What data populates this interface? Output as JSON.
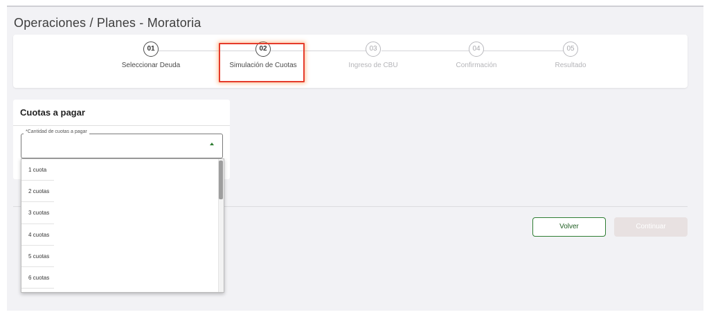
{
  "page": {
    "title": "Operaciones / Planes - Moratoria"
  },
  "stepper": {
    "steps": [
      {
        "number": "01",
        "label": "Seleccionar Deuda",
        "state": "done"
      },
      {
        "number": "02",
        "label": "Simulación de Cuotas",
        "state": "active"
      },
      {
        "number": "03",
        "label": "Ingreso de CBU",
        "state": "pending"
      },
      {
        "number": "04",
        "label": "Confirmación",
        "state": "pending"
      },
      {
        "number": "05",
        "label": "Resultado",
        "state": "pending"
      }
    ]
  },
  "panel": {
    "title": "Cuotas a pagar",
    "select_label": "*Cantidad de cuotas a pagar",
    "select_value": ""
  },
  "dropdown": {
    "options": [
      "1 cuota",
      "2 cuotas",
      "3 cuotas",
      "4 cuotas",
      "5 cuotas",
      "6 cuotas"
    ]
  },
  "actions": {
    "back_label": "Volver",
    "continue_label": "Continuar"
  },
  "colors": {
    "accent_green": "#2e7d32",
    "highlight_red": "#e53b2a",
    "disabled_button": "#e8e1e1"
  }
}
